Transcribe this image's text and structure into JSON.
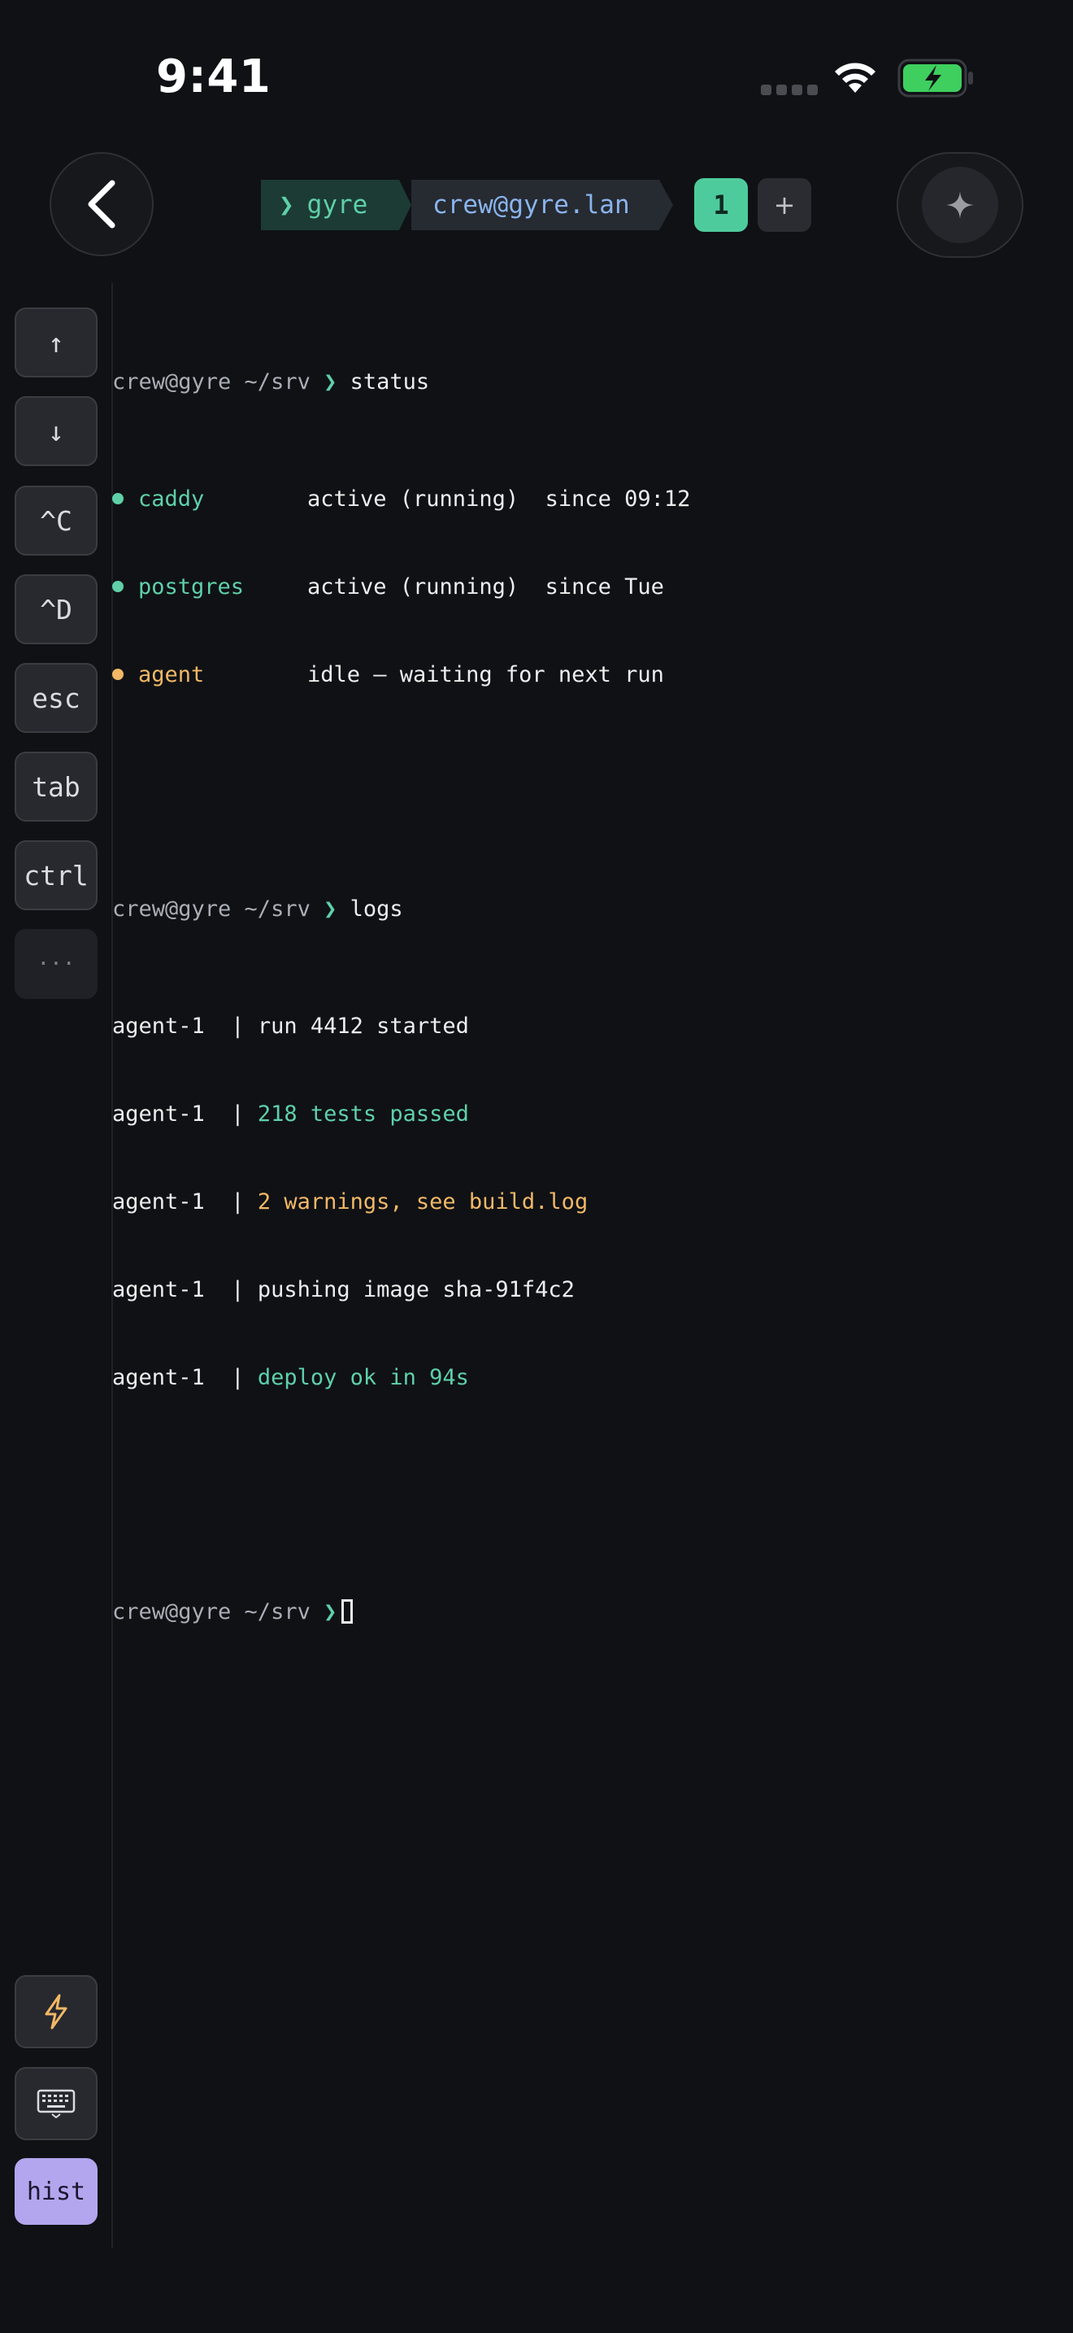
{
  "status_bar": {
    "time": "9:41",
    "signal_icon": "cellular-signal-icon",
    "wifi_icon": "wifi-icon",
    "battery_icon": "battery-charging-icon",
    "battery_color": "#3ecf5e"
  },
  "header": {
    "back_icon": "chevron-left-icon",
    "session_name": "gyre",
    "session_prompt_glyph": "❯",
    "host": "crew@gyre.lan",
    "active_tab": "1",
    "add_tab_label": "+",
    "assistant_icon": "sparkle-icon"
  },
  "keys": [
    {
      "name": "arrow-up-key",
      "label": "↑"
    },
    {
      "name": "arrow-down-key",
      "label": "↓"
    },
    {
      "name": "ctrl-c-key",
      "label": "^C"
    },
    {
      "name": "ctrl-d-key",
      "label": "^D"
    },
    {
      "name": "esc-key",
      "label": "esc"
    },
    {
      "name": "tab-key",
      "label": "tab"
    },
    {
      "name": "ctrl-key",
      "label": "ctrl"
    },
    {
      "name": "more-keys",
      "label": "···"
    }
  ],
  "bottom_keys": {
    "snippets_icon": "lightning-icon",
    "keyboard_icon": "keyboard-icon",
    "history_label": "hist"
  },
  "terminal": {
    "prompt": "crew@gyre ~/srv",
    "prompt_arrow": "❯",
    "block1": {
      "command": "status",
      "services": [
        {
          "name": "caddy",
          "state": "active (running)  since 09:12",
          "color": "#5fd0a8"
        },
        {
          "name": "postgres",
          "state": "active (running)  since Tue",
          "color": "#5fd0a8"
        },
        {
          "name": "agent",
          "state": "idle — waiting for next run",
          "color": "#f2b866"
        }
      ]
    },
    "block2": {
      "command": "logs",
      "lines": [
        {
          "source": "agent-1  | ",
          "message": "run 4412 started",
          "tone": "white"
        },
        {
          "source": "agent-1  | ",
          "message": "218 tests passed",
          "tone": "green"
        },
        {
          "source": "agent-1  | ",
          "message": "2 warnings, see build.log",
          "tone": "amber"
        },
        {
          "source": "agent-1  | ",
          "message": "pushing image sha-91f4c2",
          "tone": "white"
        },
        {
          "source": "agent-1  | ",
          "message": "deploy ok in 94s",
          "tone": "green"
        }
      ]
    }
  },
  "colors": {
    "background": "#0f1115",
    "accent_green": "#5fd0a8",
    "warning_amber": "#f2b866",
    "host_blue": "#8ab4ec",
    "hist_purple": "#b3a6ee"
  }
}
